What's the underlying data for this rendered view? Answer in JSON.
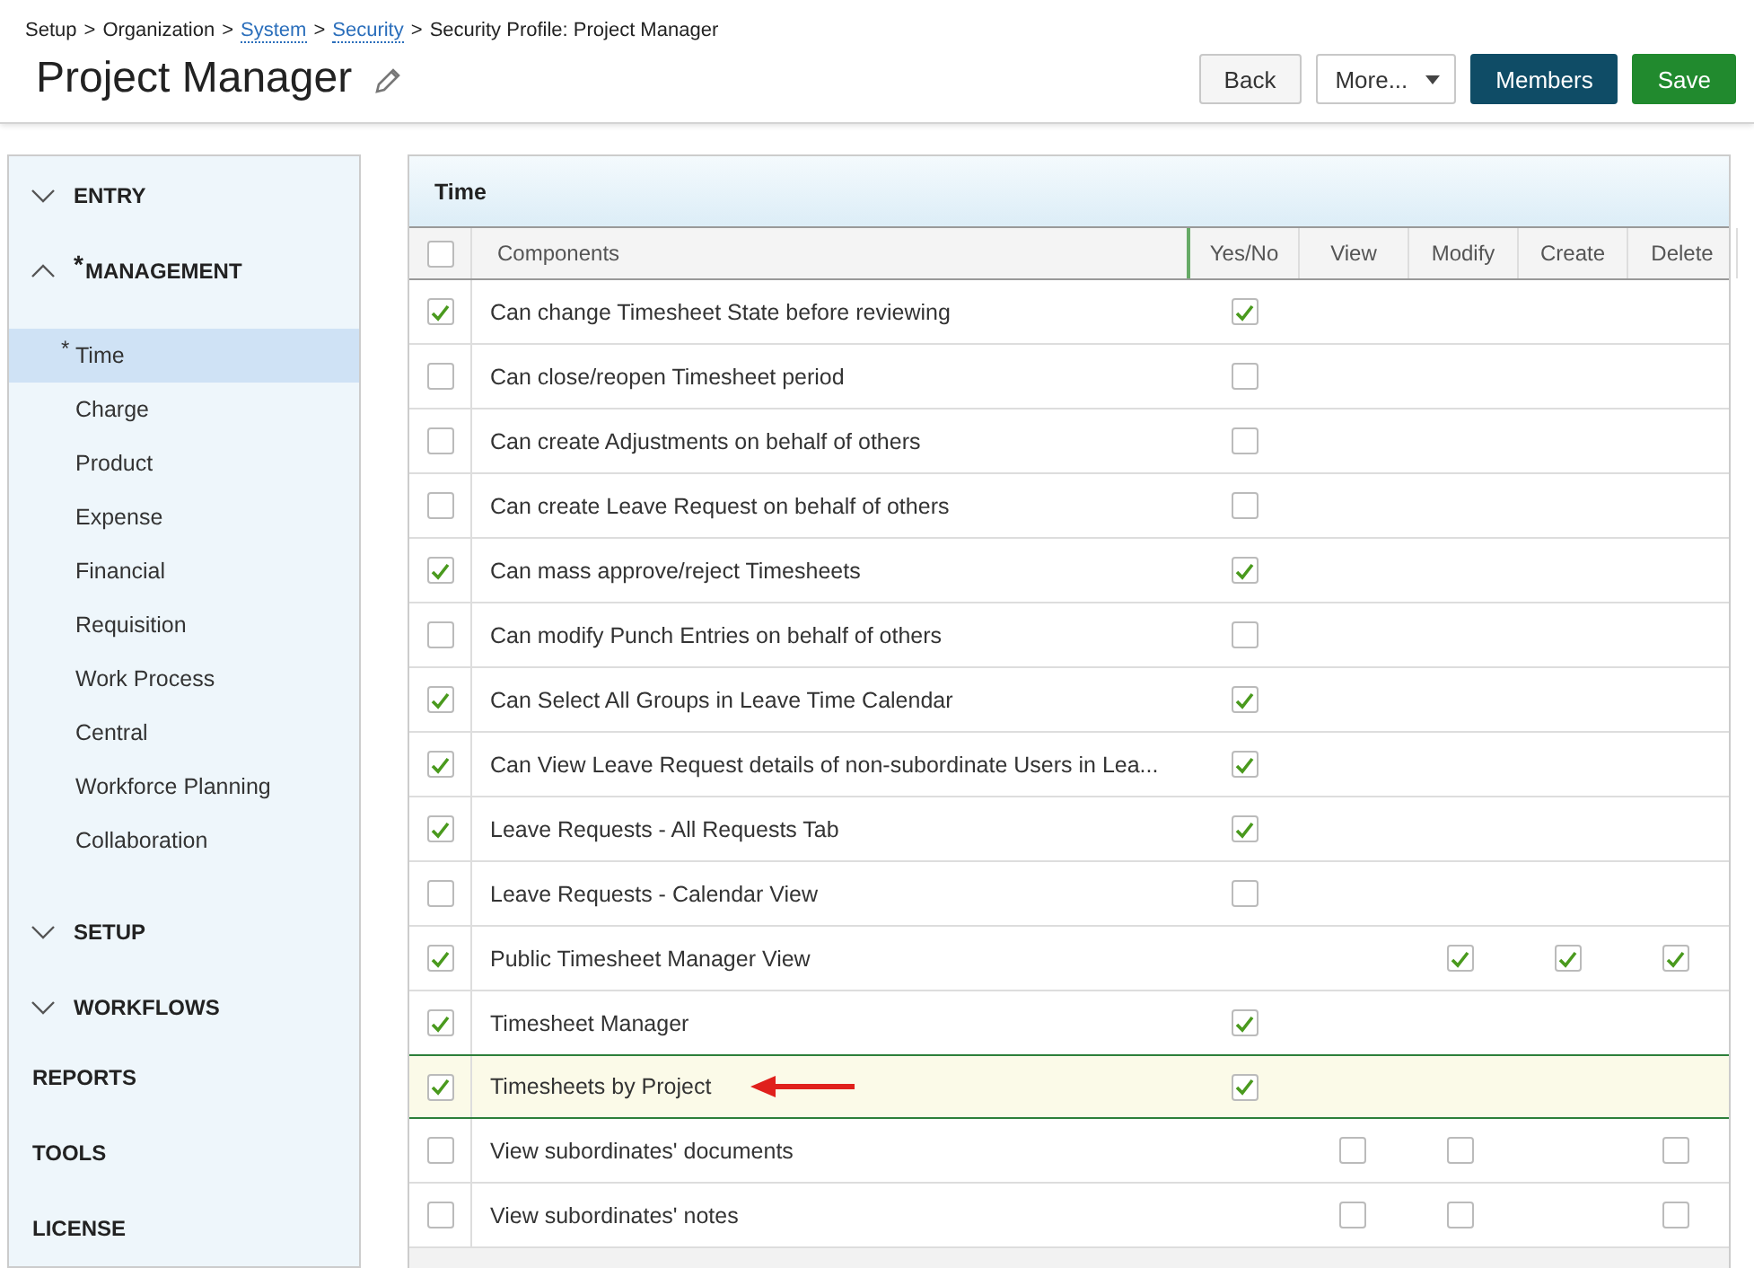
{
  "breadcrumb": {
    "separator": ">",
    "items": [
      {
        "label": "Setup",
        "link": false
      },
      {
        "label": "Organization",
        "link": false
      },
      {
        "label": "System",
        "link": true
      },
      {
        "label": "Security",
        "link": true
      },
      {
        "label": "Security Profile: Project Manager",
        "link": false
      }
    ]
  },
  "title": "Project Manager",
  "buttons": [
    {
      "label": "Back",
      "kind": "default"
    },
    {
      "label": "More...",
      "kind": "dropdown"
    },
    {
      "label": "Members",
      "kind": "dark"
    },
    {
      "label": "Save",
      "kind": "primary"
    }
  ],
  "sidebar": [
    {
      "label": "ENTRY",
      "kind": "group",
      "expanded": false
    },
    {
      "label": "MANAGEMENT",
      "kind": "group",
      "expanded": true,
      "flag": "*",
      "children": [
        {
          "label": "Time",
          "selected": true,
          "flag": "*"
        },
        {
          "label": "Charge",
          "selected": false
        },
        {
          "label": "Product",
          "selected": false
        },
        {
          "label": "Expense",
          "selected": false
        },
        {
          "label": "Financial",
          "selected": false
        },
        {
          "label": "Requisition",
          "selected": false
        },
        {
          "label": "Work Process",
          "selected": false
        },
        {
          "label": "Central",
          "selected": false
        },
        {
          "label": "Workforce Planning",
          "selected": false
        },
        {
          "label": "Collaboration",
          "selected": false
        }
      ]
    },
    {
      "label": "SETUP",
      "kind": "group",
      "expanded": false
    },
    {
      "label": "WORKFLOWS",
      "kind": "group",
      "expanded": false
    },
    {
      "label": "REPORTS",
      "kind": "link"
    },
    {
      "label": "TOOLS",
      "kind": "link"
    },
    {
      "label": "LICENSE",
      "kind": "link"
    }
  ],
  "panel": {
    "title": "Time",
    "columns": [
      "Components",
      "Yes/No",
      "View",
      "Modify",
      "Create",
      "Delete"
    ],
    "select_all": {
      "checked": false
    },
    "rows": [
      {
        "name": "Can change Timesheet State before reviewing",
        "checked": true,
        "selected": false,
        "arrow": false,
        "perms": [
          {
            "kind": "checkbox",
            "checked": true
          },
          {
            "kind": "none"
          },
          {
            "kind": "none"
          },
          {
            "kind": "none"
          },
          {
            "kind": "none"
          }
        ]
      },
      {
        "name": "Can close/reopen Timesheet period",
        "checked": false,
        "selected": false,
        "arrow": false,
        "perms": [
          {
            "kind": "checkbox",
            "checked": false
          },
          {
            "kind": "none"
          },
          {
            "kind": "none"
          },
          {
            "kind": "none"
          },
          {
            "kind": "none"
          }
        ]
      },
      {
        "name": "Can create Adjustments on behalf of others",
        "checked": false,
        "selected": false,
        "arrow": false,
        "perms": [
          {
            "kind": "checkbox",
            "checked": false
          },
          {
            "kind": "none"
          },
          {
            "kind": "none"
          },
          {
            "kind": "none"
          },
          {
            "kind": "none"
          }
        ]
      },
      {
        "name": "Can create Leave Request on behalf of others",
        "checked": false,
        "selected": false,
        "arrow": false,
        "perms": [
          {
            "kind": "checkbox",
            "checked": false
          },
          {
            "kind": "none"
          },
          {
            "kind": "none"
          },
          {
            "kind": "none"
          },
          {
            "kind": "none"
          }
        ]
      },
      {
        "name": "Can mass approve/reject Timesheets",
        "checked": true,
        "selected": false,
        "arrow": false,
        "perms": [
          {
            "kind": "checkbox",
            "checked": true
          },
          {
            "kind": "none"
          },
          {
            "kind": "none"
          },
          {
            "kind": "none"
          },
          {
            "kind": "none"
          }
        ]
      },
      {
        "name": "Can modify Punch Entries on behalf of others",
        "checked": false,
        "selected": false,
        "arrow": false,
        "perms": [
          {
            "kind": "checkbox",
            "checked": false
          },
          {
            "kind": "none"
          },
          {
            "kind": "none"
          },
          {
            "kind": "none"
          },
          {
            "kind": "none"
          }
        ]
      },
      {
        "name": "Can Select All Groups in Leave Time Calendar",
        "checked": true,
        "selected": false,
        "arrow": false,
        "perms": [
          {
            "kind": "checkbox",
            "checked": true
          },
          {
            "kind": "none"
          },
          {
            "kind": "none"
          },
          {
            "kind": "none"
          },
          {
            "kind": "none"
          }
        ]
      },
      {
        "name": "Can View Leave Request details of non-subordinate Users in Lea...",
        "checked": true,
        "selected": false,
        "arrow": false,
        "perms": [
          {
            "kind": "checkbox",
            "checked": true
          },
          {
            "kind": "none"
          },
          {
            "kind": "none"
          },
          {
            "kind": "none"
          },
          {
            "kind": "none"
          }
        ]
      },
      {
        "name": "Leave Requests - All Requests Tab",
        "checked": true,
        "selected": false,
        "arrow": false,
        "perms": [
          {
            "kind": "checkbox",
            "checked": true
          },
          {
            "kind": "none"
          },
          {
            "kind": "none"
          },
          {
            "kind": "none"
          },
          {
            "kind": "none"
          }
        ]
      },
      {
        "name": "Leave Requests - Calendar View",
        "checked": false,
        "selected": false,
        "arrow": false,
        "perms": [
          {
            "kind": "checkbox",
            "checked": false
          },
          {
            "kind": "none"
          },
          {
            "kind": "none"
          },
          {
            "kind": "none"
          },
          {
            "kind": "none"
          }
        ]
      },
      {
        "name": "Public Timesheet Manager View",
        "checked": true,
        "selected": false,
        "arrow": false,
        "perms": [
          {
            "kind": "none"
          },
          {
            "kind": "none"
          },
          {
            "kind": "checkbox",
            "checked": true
          },
          {
            "kind": "checkbox",
            "checked": true
          },
          {
            "kind": "checkbox",
            "checked": true
          }
        ]
      },
      {
        "name": "Timesheet Manager",
        "checked": true,
        "selected": false,
        "arrow": false,
        "perms": [
          {
            "kind": "checkbox",
            "checked": true
          },
          {
            "kind": "none"
          },
          {
            "kind": "none"
          },
          {
            "kind": "none"
          },
          {
            "kind": "none"
          }
        ]
      },
      {
        "name": "Timesheets by Project",
        "checked": true,
        "selected": true,
        "arrow": true,
        "perms": [
          {
            "kind": "checkbox",
            "checked": true
          },
          {
            "kind": "none"
          },
          {
            "kind": "none"
          },
          {
            "kind": "none"
          },
          {
            "kind": "none"
          }
        ]
      },
      {
        "name": "View subordinates' documents",
        "checked": false,
        "selected": false,
        "arrow": false,
        "perms": [
          {
            "kind": "none"
          },
          {
            "kind": "checkbox",
            "checked": false
          },
          {
            "kind": "checkbox",
            "checked": false
          },
          {
            "kind": "none"
          },
          {
            "kind": "checkbox",
            "checked": false
          }
        ]
      },
      {
        "name": "View subordinates' notes",
        "checked": false,
        "selected": false,
        "arrow": false,
        "perms": [
          {
            "kind": "none"
          },
          {
            "kind": "checkbox",
            "checked": false
          },
          {
            "kind": "checkbox",
            "checked": false
          },
          {
            "kind": "none"
          },
          {
            "kind": "checkbox",
            "checked": false
          }
        ]
      }
    ]
  }
}
